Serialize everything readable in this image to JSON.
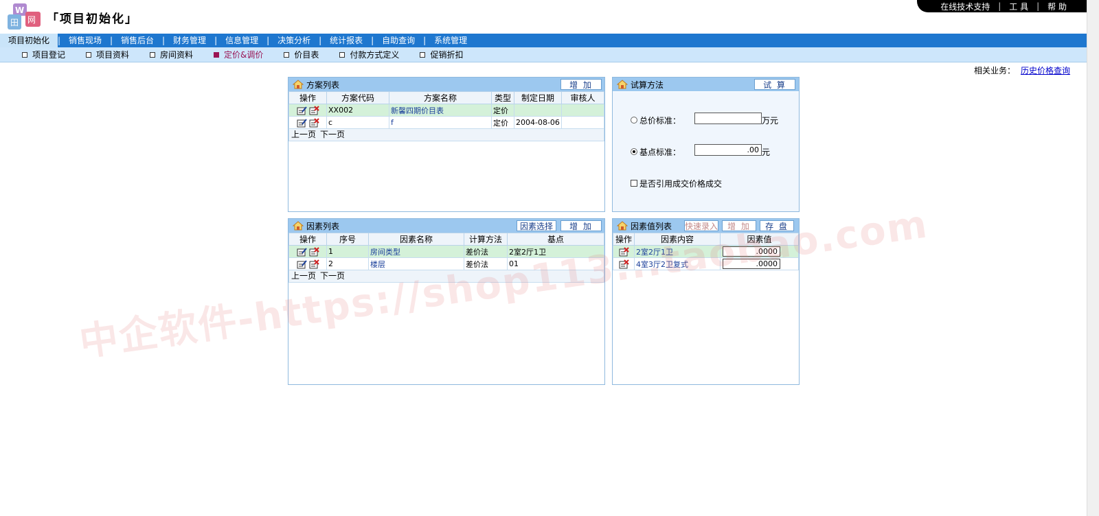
{
  "header": {
    "title": "「项目初始化」",
    "topbar": [
      "在线技术支持",
      "工 具",
      "帮 助"
    ]
  },
  "main_nav": {
    "items": [
      "项目初始化",
      "销售现场",
      "销售后台",
      "财务管理",
      "信息管理",
      "决策分析",
      "统计报表",
      "自助查询",
      "系统管理"
    ],
    "active": "项目初始化"
  },
  "sub_nav": {
    "items": [
      "项目登记",
      "项目资料",
      "房间资料",
      "定价&调价",
      "价目表",
      "付款方式定义",
      "促销折扣"
    ],
    "active": "定价&调价"
  },
  "related": {
    "label": "相关业务：",
    "link": "历史价格查询"
  },
  "plan_panel": {
    "title": "方案列表",
    "add_label": "增 加",
    "columns": [
      "操作",
      "方案代码",
      "方案名称",
      "类型",
      "制定日期",
      "审核人"
    ],
    "rows": [
      {
        "code": "XX002",
        "name": "新馨四期价目表",
        "type": "定价",
        "date": "",
        "reviewer": ""
      },
      {
        "code": "c",
        "name": "f",
        "type": "定价",
        "date": "2004-08-06",
        "reviewer": ""
      }
    ],
    "prev": "上一页",
    "next": "下一页"
  },
  "calc_panel": {
    "title": "试算方法",
    "calc_label": "试 算",
    "total_label": "总价标准：",
    "total_value": "",
    "total_unit": "万元",
    "base_label": "基点标准：",
    "base_value": ".00",
    "base_unit": "元",
    "checkbox_label": "是否引用成交价格成交",
    "selected": "base"
  },
  "factor_panel": {
    "title": "因素列表",
    "select_label": "因素选择",
    "add_label": "增 加",
    "columns": [
      "操作",
      "序号",
      "因素名称",
      "计算方法",
      "基点"
    ],
    "rows": [
      {
        "no": "1",
        "name": "房间类型",
        "method": "差价法",
        "base": "2室2厅1卫"
      },
      {
        "no": "2",
        "name": "楼层",
        "method": "差价法",
        "base": "01"
      }
    ],
    "prev": "上一页",
    "next": "下一页"
  },
  "value_panel": {
    "title": "因素值列表",
    "quick_label": "快速录入",
    "add_label": "增 加",
    "save_label": "存 盘",
    "columns": [
      "操作",
      "因素内容",
      "因素值"
    ],
    "rows": [
      {
        "content": "2室2厅1卫",
        "value": ".0000"
      },
      {
        "content": "4室3厅2卫复式",
        "value": ".0000"
      }
    ]
  },
  "watermark": "中企软件-https://shop113...taobao.com",
  "colors": {
    "nav_bg": "#1e77cf",
    "subnav_bg": "#cde6fb",
    "panel_head": "#9cc8ef",
    "selected_row": "#d4f1d9",
    "active_sub": "#9a1454"
  }
}
